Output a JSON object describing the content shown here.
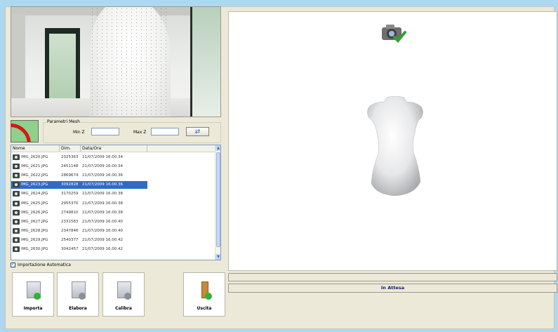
{
  "params": {
    "legend": "Parametri Mesh",
    "min_label": "Min Z",
    "max_label": "Max Z",
    "min_value": "",
    "max_value": ""
  },
  "list": {
    "headers": [
      "Nome",
      "Dim.",
      "Data/Ora"
    ],
    "rows": [
      [
        "IMG_2620.JPG",
        "2325363",
        "21/07/2009 16.00.34"
      ],
      [
        "IMG_2621.JPG",
        "2451148",
        "21/07/2009 16.00.34"
      ],
      [
        "IMG_2622.JPG",
        "2869674",
        "21/07/2009 16.00.36"
      ],
      [
        "IMG_2623.JPG",
        "3092828",
        "21/07/2009 16.00.36"
      ],
      [
        "IMG_2624.JPG",
        "3170259",
        "21/07/2009 16.00.38"
      ],
      [
        "IMG_2625.JPG",
        "2955370",
        "21/07/2009 16.00.38"
      ],
      [
        "IMG_2626.JPG",
        "2749810",
        "21/07/2009 16.00.38"
      ],
      [
        "IMG_2627.JPG",
        "2331583",
        "21/07/2009 16.00.40"
      ],
      [
        "IMG_2628.JPG",
        "2347846",
        "21/07/2009 16.00.40"
      ],
      [
        "IMG_2629.JPG",
        "2540377",
        "21/07/2009 16.00.42"
      ],
      [
        "IMG_2630.JPG",
        "3042457",
        "21/07/2009 16.00.42"
      ]
    ],
    "selected_index": 3
  },
  "auto_import": {
    "label": "Importazione Automatica",
    "checked": true
  },
  "toolbar": {
    "import_label": "Importa",
    "process_label": "Elabora",
    "calibrate_label": "Calibra",
    "exit_label": "Uscita"
  },
  "status": {
    "line1": "",
    "line2": "In Attesa"
  },
  "colors": {
    "selection": "#316ac5",
    "status_text": "#0c1e7a",
    "background": "#aed8ef"
  }
}
